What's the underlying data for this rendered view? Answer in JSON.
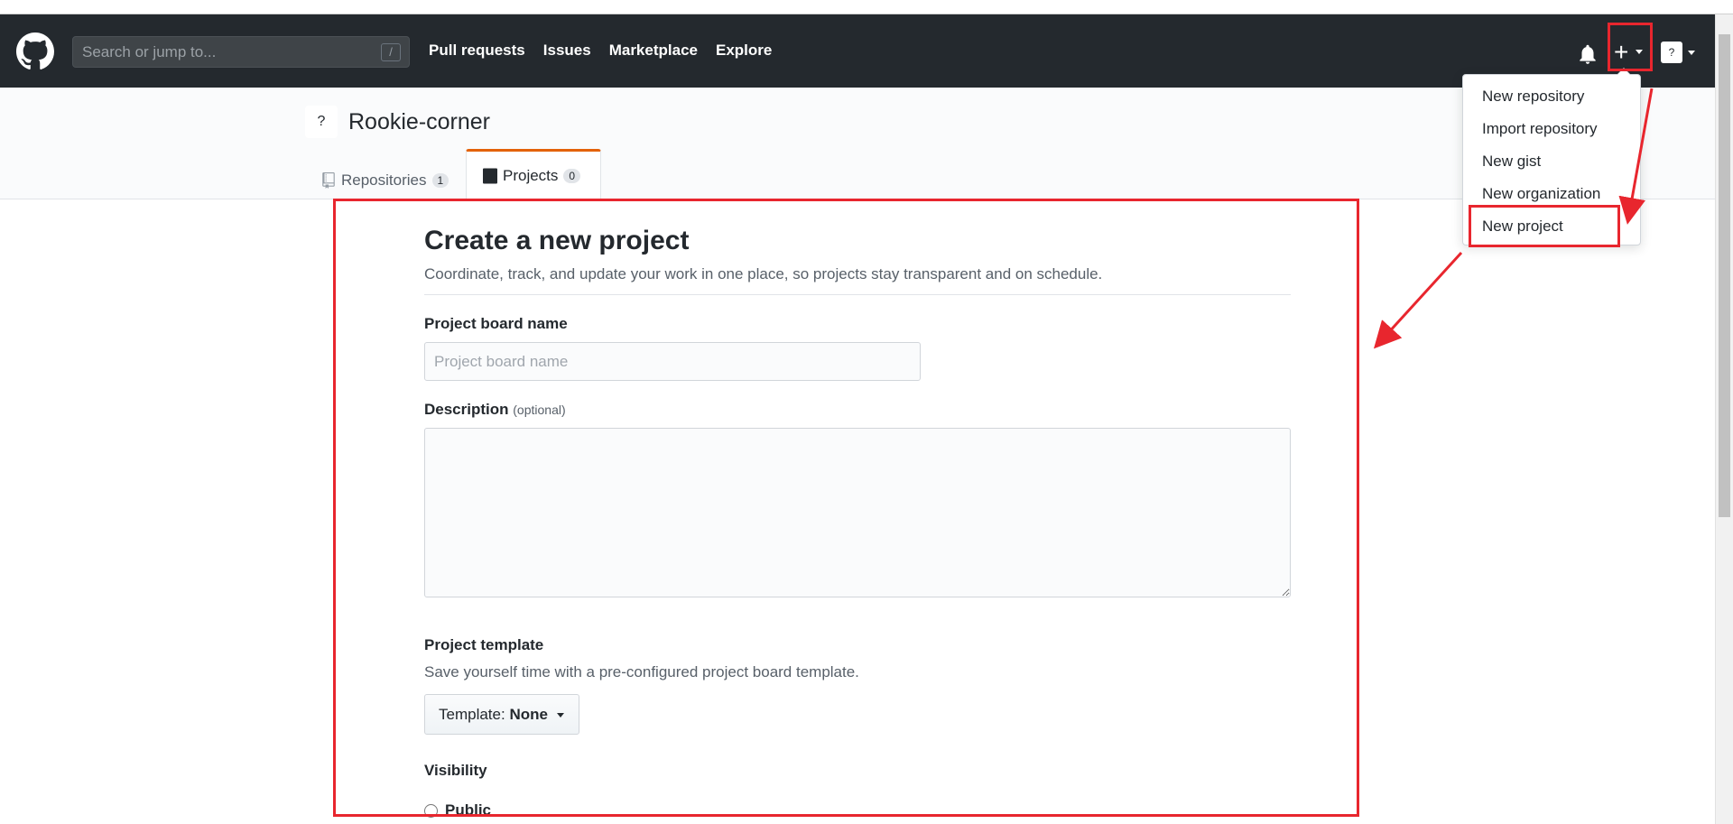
{
  "header": {
    "search_placeholder": "Search or jump to...",
    "search_shortcut": "/",
    "nav": [
      "Pull requests",
      "Issues",
      "Marketplace",
      "Explore"
    ]
  },
  "user_menu": {
    "items": [
      "New repository",
      "Import repository",
      "New gist",
      "New organization",
      "New project"
    ]
  },
  "profile": {
    "name": "Rookie-corner",
    "tabs": [
      {
        "label": "Repositories",
        "count": "1"
      },
      {
        "label": "Projects",
        "count": "0"
      }
    ]
  },
  "form": {
    "title": "Create a new project",
    "subtitle": "Coordinate, track, and update your work in one place, so projects stay transparent and on schedule.",
    "name_label": "Project board name",
    "name_placeholder": "Project board name",
    "description_label": "Description",
    "description_optional": "(optional)",
    "template_label": "Project template",
    "template_help": "Save yourself time with a pre-configured project board template.",
    "template_button_prefix": "Template:",
    "template_button_value": "None",
    "visibility_label": "Visibility",
    "visibility_option": "Public"
  },
  "colors": {
    "header_bg": "#24292e",
    "annotation_red": "#e8262e",
    "tab_accent": "#e36209"
  }
}
